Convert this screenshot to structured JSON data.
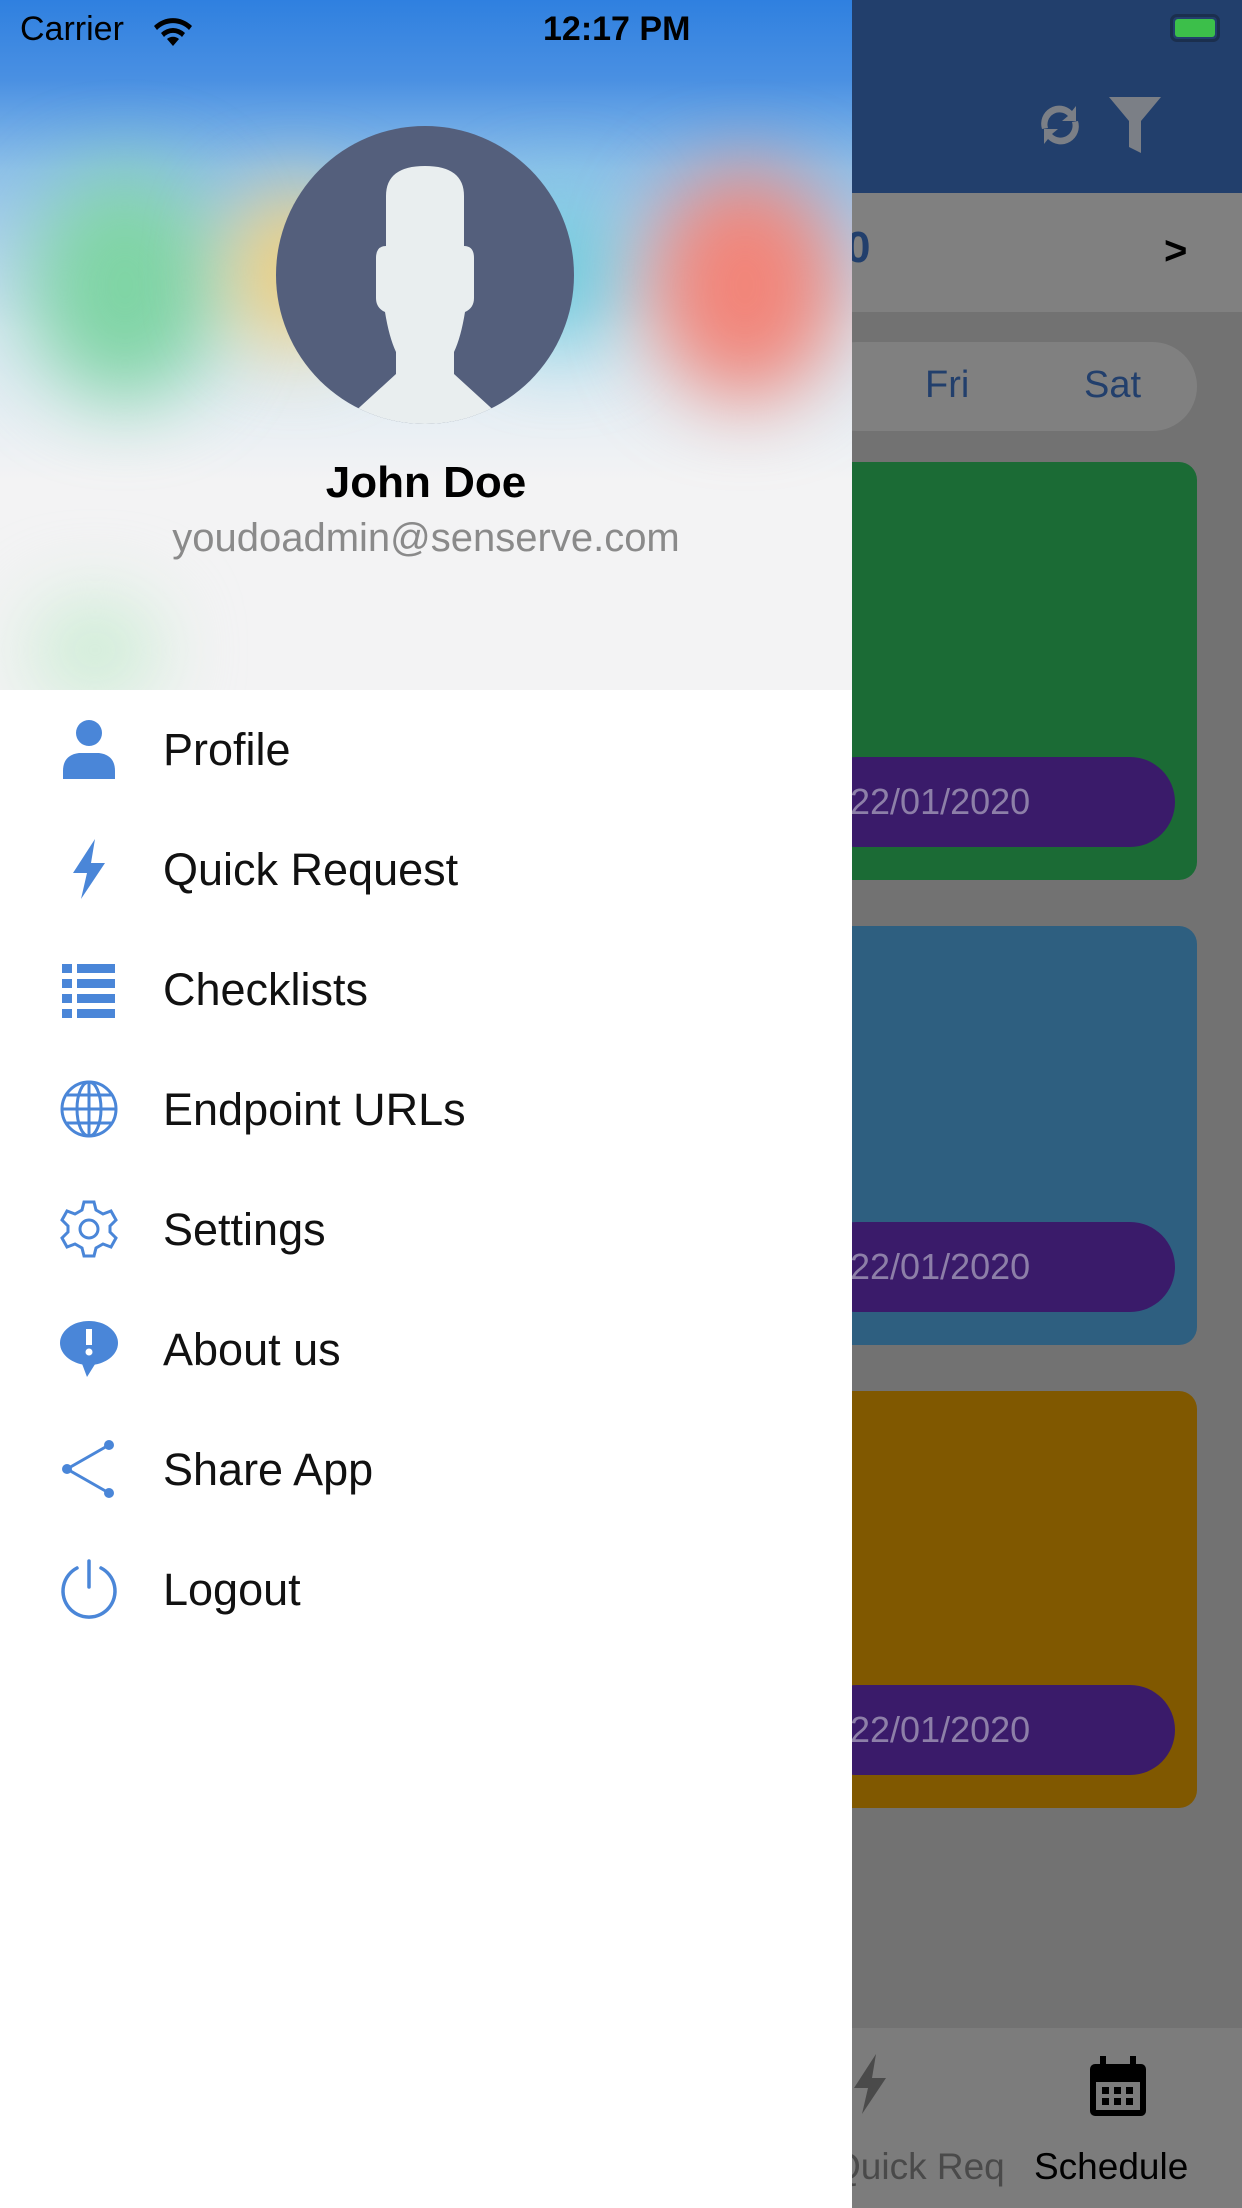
{
  "status_bar": {
    "carrier": "Carrier",
    "time": "12:17 PM"
  },
  "profile": {
    "name": "John Doe",
    "email": "youdoadmin@senserve.com"
  },
  "menu": {
    "items": [
      {
        "label": "Profile",
        "icon": "person-icon"
      },
      {
        "label": "Quick Request",
        "icon": "bolt-icon"
      },
      {
        "label": "Checklists",
        "icon": "list-icon"
      },
      {
        "label": "Endpoint URLs",
        "icon": "globe-icon"
      },
      {
        "label": "Settings",
        "icon": "gear-icon"
      },
      {
        "label": "About us",
        "icon": "speech-bubble-icon"
      },
      {
        "label": "Share App",
        "icon": "share-icon"
      },
      {
        "label": "Logout",
        "icon": "power-icon"
      }
    ]
  },
  "background": {
    "date_partial": "0",
    "next_label": ">",
    "days": [
      "Fri",
      "Sat"
    ],
    "cards": [
      {
        "color": "#1b6b35",
        "date": "22/01/2020"
      },
      {
        "color": "#2e5f80",
        "date": "22/01/2020"
      },
      {
        "color": "#805800",
        "date": "22/01/2020"
      }
    ],
    "tabs": [
      {
        "label": "Quick Req",
        "icon": "bolt-icon"
      },
      {
        "label": "Schedule",
        "icon": "calendar-icon"
      }
    ]
  },
  "colors": {
    "accent": "#4a86d8",
    "nav": "#223f6c",
    "date_pill": "#3a1b6a"
  }
}
